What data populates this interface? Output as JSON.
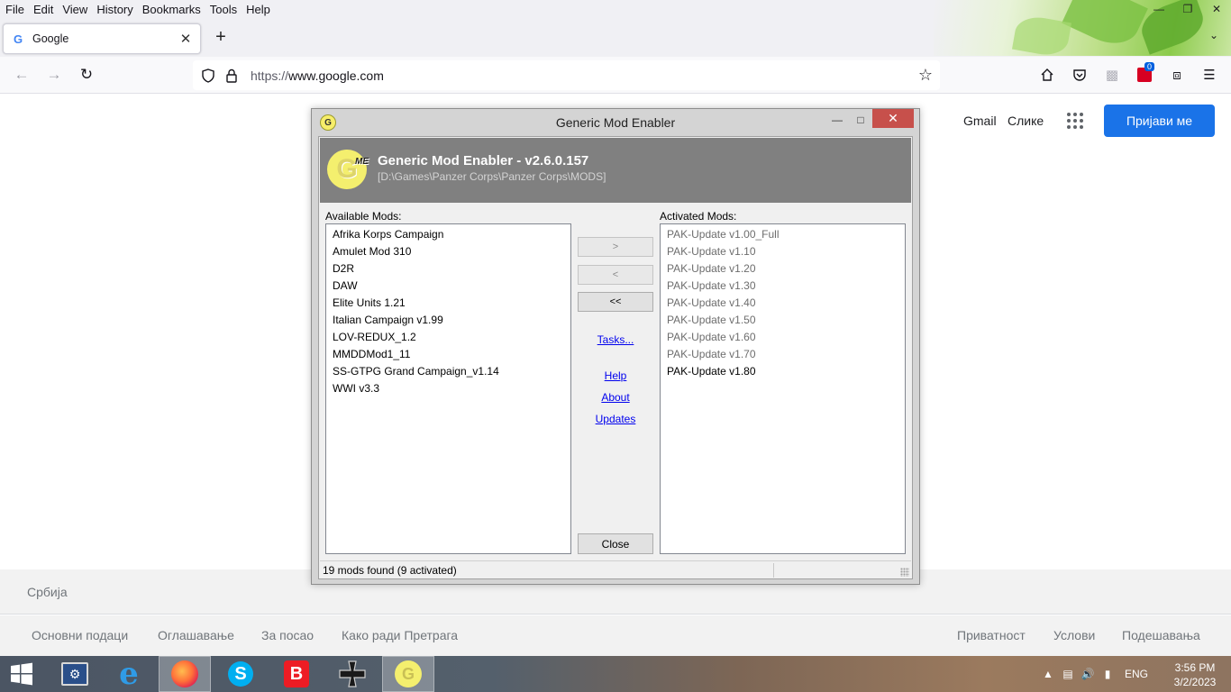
{
  "browser": {
    "menu": [
      "File",
      "Edit",
      "View",
      "History",
      "Bookmarks",
      "Tools",
      "Help"
    ],
    "tab_title": "Google",
    "url_host": "www.google.com",
    "url_prefix": "https://",
    "badge_count": "0"
  },
  "google": {
    "gmail": "Gmail",
    "images": "Слике",
    "signin": "Пријави ме",
    "country": "Србија",
    "footer_left": [
      "Основни подаци",
      "Оглашавање",
      "За посао",
      "Како ради Претрага"
    ],
    "footer_right": [
      "Приватност",
      "Услови",
      "Подешавања"
    ]
  },
  "gme": {
    "window_title": "Generic Mod Enabler",
    "app_title": "Generic Mod Enabler - v2.6.0.157",
    "path": "[D:\\Games\\Panzer Corps\\Panzer Corps\\MODS]",
    "available_label": "Available Mods:",
    "activated_label": "Activated Mods:",
    "available_mods": [
      "Afrika Korps Campaign",
      "Amulet Mod 310",
      "D2R",
      "DAW",
      "Elite Units 1.21",
      "Italian Campaign v1.99",
      "LOV-REDUX_1.2",
      "MMDDMod1_11",
      "SS-GTPG Grand Campaign_v1.14",
      "WWI v3.3"
    ],
    "activated_mods": [
      "PAK-Update v1.00_Full",
      "PAK-Update v1.10",
      "PAK-Update v1.20",
      "PAK-Update v1.30",
      "PAK-Update v1.40",
      "PAK-Update v1.50",
      "PAK-Update v1.60",
      "PAK-Update v1.70",
      "PAK-Update v1.80"
    ],
    "btn_add": ">",
    "btn_remove": "<",
    "btn_remove_all": "<<",
    "link_tasks": "Tasks...",
    "link_help": "Help",
    "link_about": "About",
    "link_updates": "Updates",
    "btn_close": "Close",
    "status": "19 mods found (9 activated)"
  },
  "taskbar": {
    "lang": "ENG",
    "time": "3:56 PM",
    "date": "3/2/2023"
  }
}
